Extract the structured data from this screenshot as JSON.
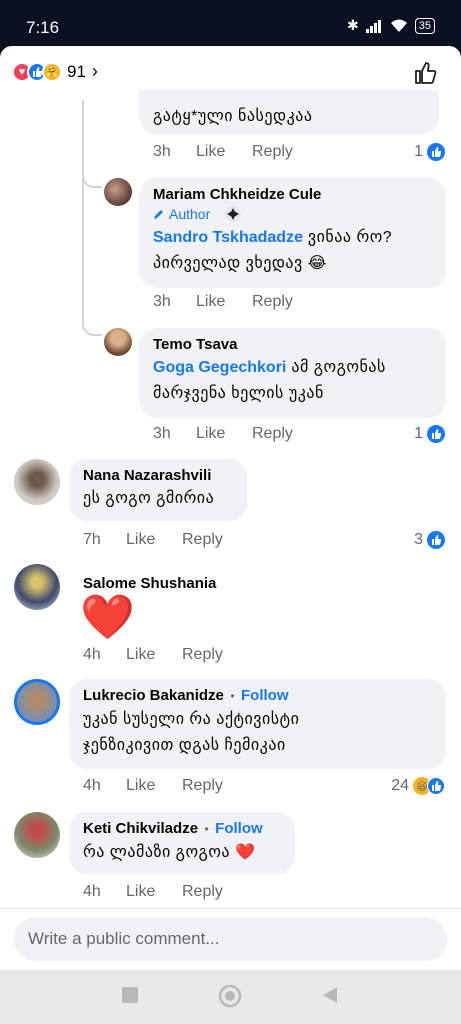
{
  "status_bar": {
    "time": "7:16",
    "battery": "35"
  },
  "reactions_header": {
    "count": "91"
  },
  "comments": [
    {
      "text": "გატყ*ული ნასედკაა",
      "time": "3h",
      "like": "Like",
      "reply": "Reply",
      "reaction_count": "1"
    },
    {
      "name": "Mariam Chkheidze Cule",
      "badge": "Author",
      "mention": "Sandro Tskhadadze",
      "text_a": " ვინაა რო?",
      "text_b": "პირველად ვხედავ 😂",
      "time": "3h",
      "like": "Like",
      "reply": "Reply"
    },
    {
      "name": "Temo Tsava",
      "mention": "Goga Gegechkori",
      "text_a": " ამ გოგონას",
      "text_b": "მარჯვენა ხელის უკან",
      "time": "3h",
      "like": "Like",
      "reply": "Reply",
      "reaction_count": "1"
    },
    {
      "name": "Nana Nazarashvili",
      "text": "ეს გოგო გმირია",
      "time": "7h",
      "like": "Like",
      "reply": "Reply",
      "reaction_count": "3"
    },
    {
      "name": "Salome Shushania",
      "text": "❤️",
      "time": "4h",
      "like": "Like",
      "reply": "Reply"
    },
    {
      "name": "Lukrecio Bakanidze",
      "follow": "Follow",
      "text_a": "უკან სუსელი რა აქტივისტი",
      "text_b": "ჯენზიკივით დგას ჩემიკაი",
      "time": "4h",
      "like": "Like",
      "reply": "Reply",
      "reaction_count": "24"
    },
    {
      "name": "Keti Chikviladze",
      "follow": "Follow",
      "text": "რა ლამაზი გოგოა ❤️",
      "time": "4h",
      "like": "Like",
      "reply": "Reply"
    }
  ],
  "composer": {
    "placeholder": "Write a public comment..."
  },
  "colors": {
    "link_blue": "#1877f2",
    "bubble_bg": "#f0f2f5",
    "meta_gray": "#65676b"
  }
}
